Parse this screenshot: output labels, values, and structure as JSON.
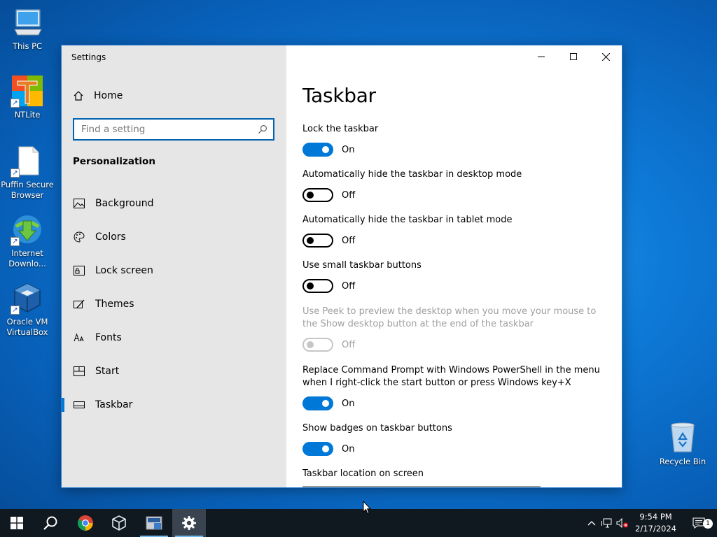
{
  "desktop": {
    "icons": [
      {
        "label": "This PC",
        "icon": "computer-icon"
      },
      {
        "label": "NTLite",
        "icon": "ntlite-icon"
      },
      {
        "label": "Puffin Secure Browser",
        "icon": "file-icon"
      },
      {
        "label": "Internet Downlo...",
        "icon": "idm-icon"
      },
      {
        "label": "Oracle VM VirtualBox",
        "icon": "virtualbox-icon"
      },
      {
        "label": "Recycle Bin",
        "icon": "recycle-bin-icon"
      }
    ]
  },
  "window": {
    "title": "Settings",
    "controls": {
      "minimize": "minimize-icon",
      "maximize": "maximize-icon",
      "close": "close-icon"
    }
  },
  "sidebar": {
    "home_label": "Home",
    "search_placeholder": "Find a setting",
    "section_heading": "Personalization",
    "items": [
      {
        "label": "Background",
        "icon": "image-icon",
        "active": false
      },
      {
        "label": "Colors",
        "icon": "palette-icon",
        "active": false
      },
      {
        "label": "Lock screen",
        "icon": "lock-screen-icon",
        "active": false
      },
      {
        "label": "Themes",
        "icon": "themes-icon",
        "active": false
      },
      {
        "label": "Fonts",
        "icon": "fonts-icon",
        "active": false
      },
      {
        "label": "Start",
        "icon": "start-icon",
        "active": false
      },
      {
        "label": "Taskbar",
        "icon": "taskbar-icon",
        "active": true
      }
    ]
  },
  "content": {
    "title": "Taskbar",
    "settings": [
      {
        "label": "Lock the taskbar",
        "state": "On",
        "on": true,
        "disabled": false
      },
      {
        "label": "Automatically hide the taskbar in desktop mode",
        "state": "Off",
        "on": false,
        "disabled": false
      },
      {
        "label": "Automatically hide the taskbar in tablet mode",
        "state": "Off",
        "on": false,
        "disabled": false
      },
      {
        "label": "Use small taskbar buttons",
        "state": "Off",
        "on": false,
        "disabled": false
      },
      {
        "label": "Use Peek to preview the desktop when you move your mouse to the Show desktop button at the end of the taskbar",
        "state": "Off",
        "on": false,
        "disabled": true
      },
      {
        "label": "Replace Command Prompt with Windows PowerShell in the menu when I right-click the start button or press Windows key+X",
        "state": "On",
        "on": true,
        "disabled": false
      },
      {
        "label": "Show badges on taskbar buttons",
        "state": "On",
        "on": true,
        "disabled": false
      }
    ],
    "location_label": "Taskbar location on screen"
  },
  "taskbar": {
    "apps": [
      {
        "name": "start",
        "icon": "windows-logo-icon"
      },
      {
        "name": "search",
        "icon": "search-icon"
      },
      {
        "name": "chrome",
        "icon": "chrome-icon"
      },
      {
        "name": "virtualbox",
        "icon": "virtualbox-icon"
      },
      {
        "name": "ntlite",
        "icon": "ntlite-icon"
      },
      {
        "name": "settings",
        "icon": "gear-icon"
      }
    ],
    "time": "9:54 PM",
    "date": "2/17/2024",
    "notification_count": "1"
  },
  "colors": {
    "accent": "#0078d7",
    "sidebar_bg": "#e6e6e6",
    "taskbar_bg": "#101820"
  }
}
